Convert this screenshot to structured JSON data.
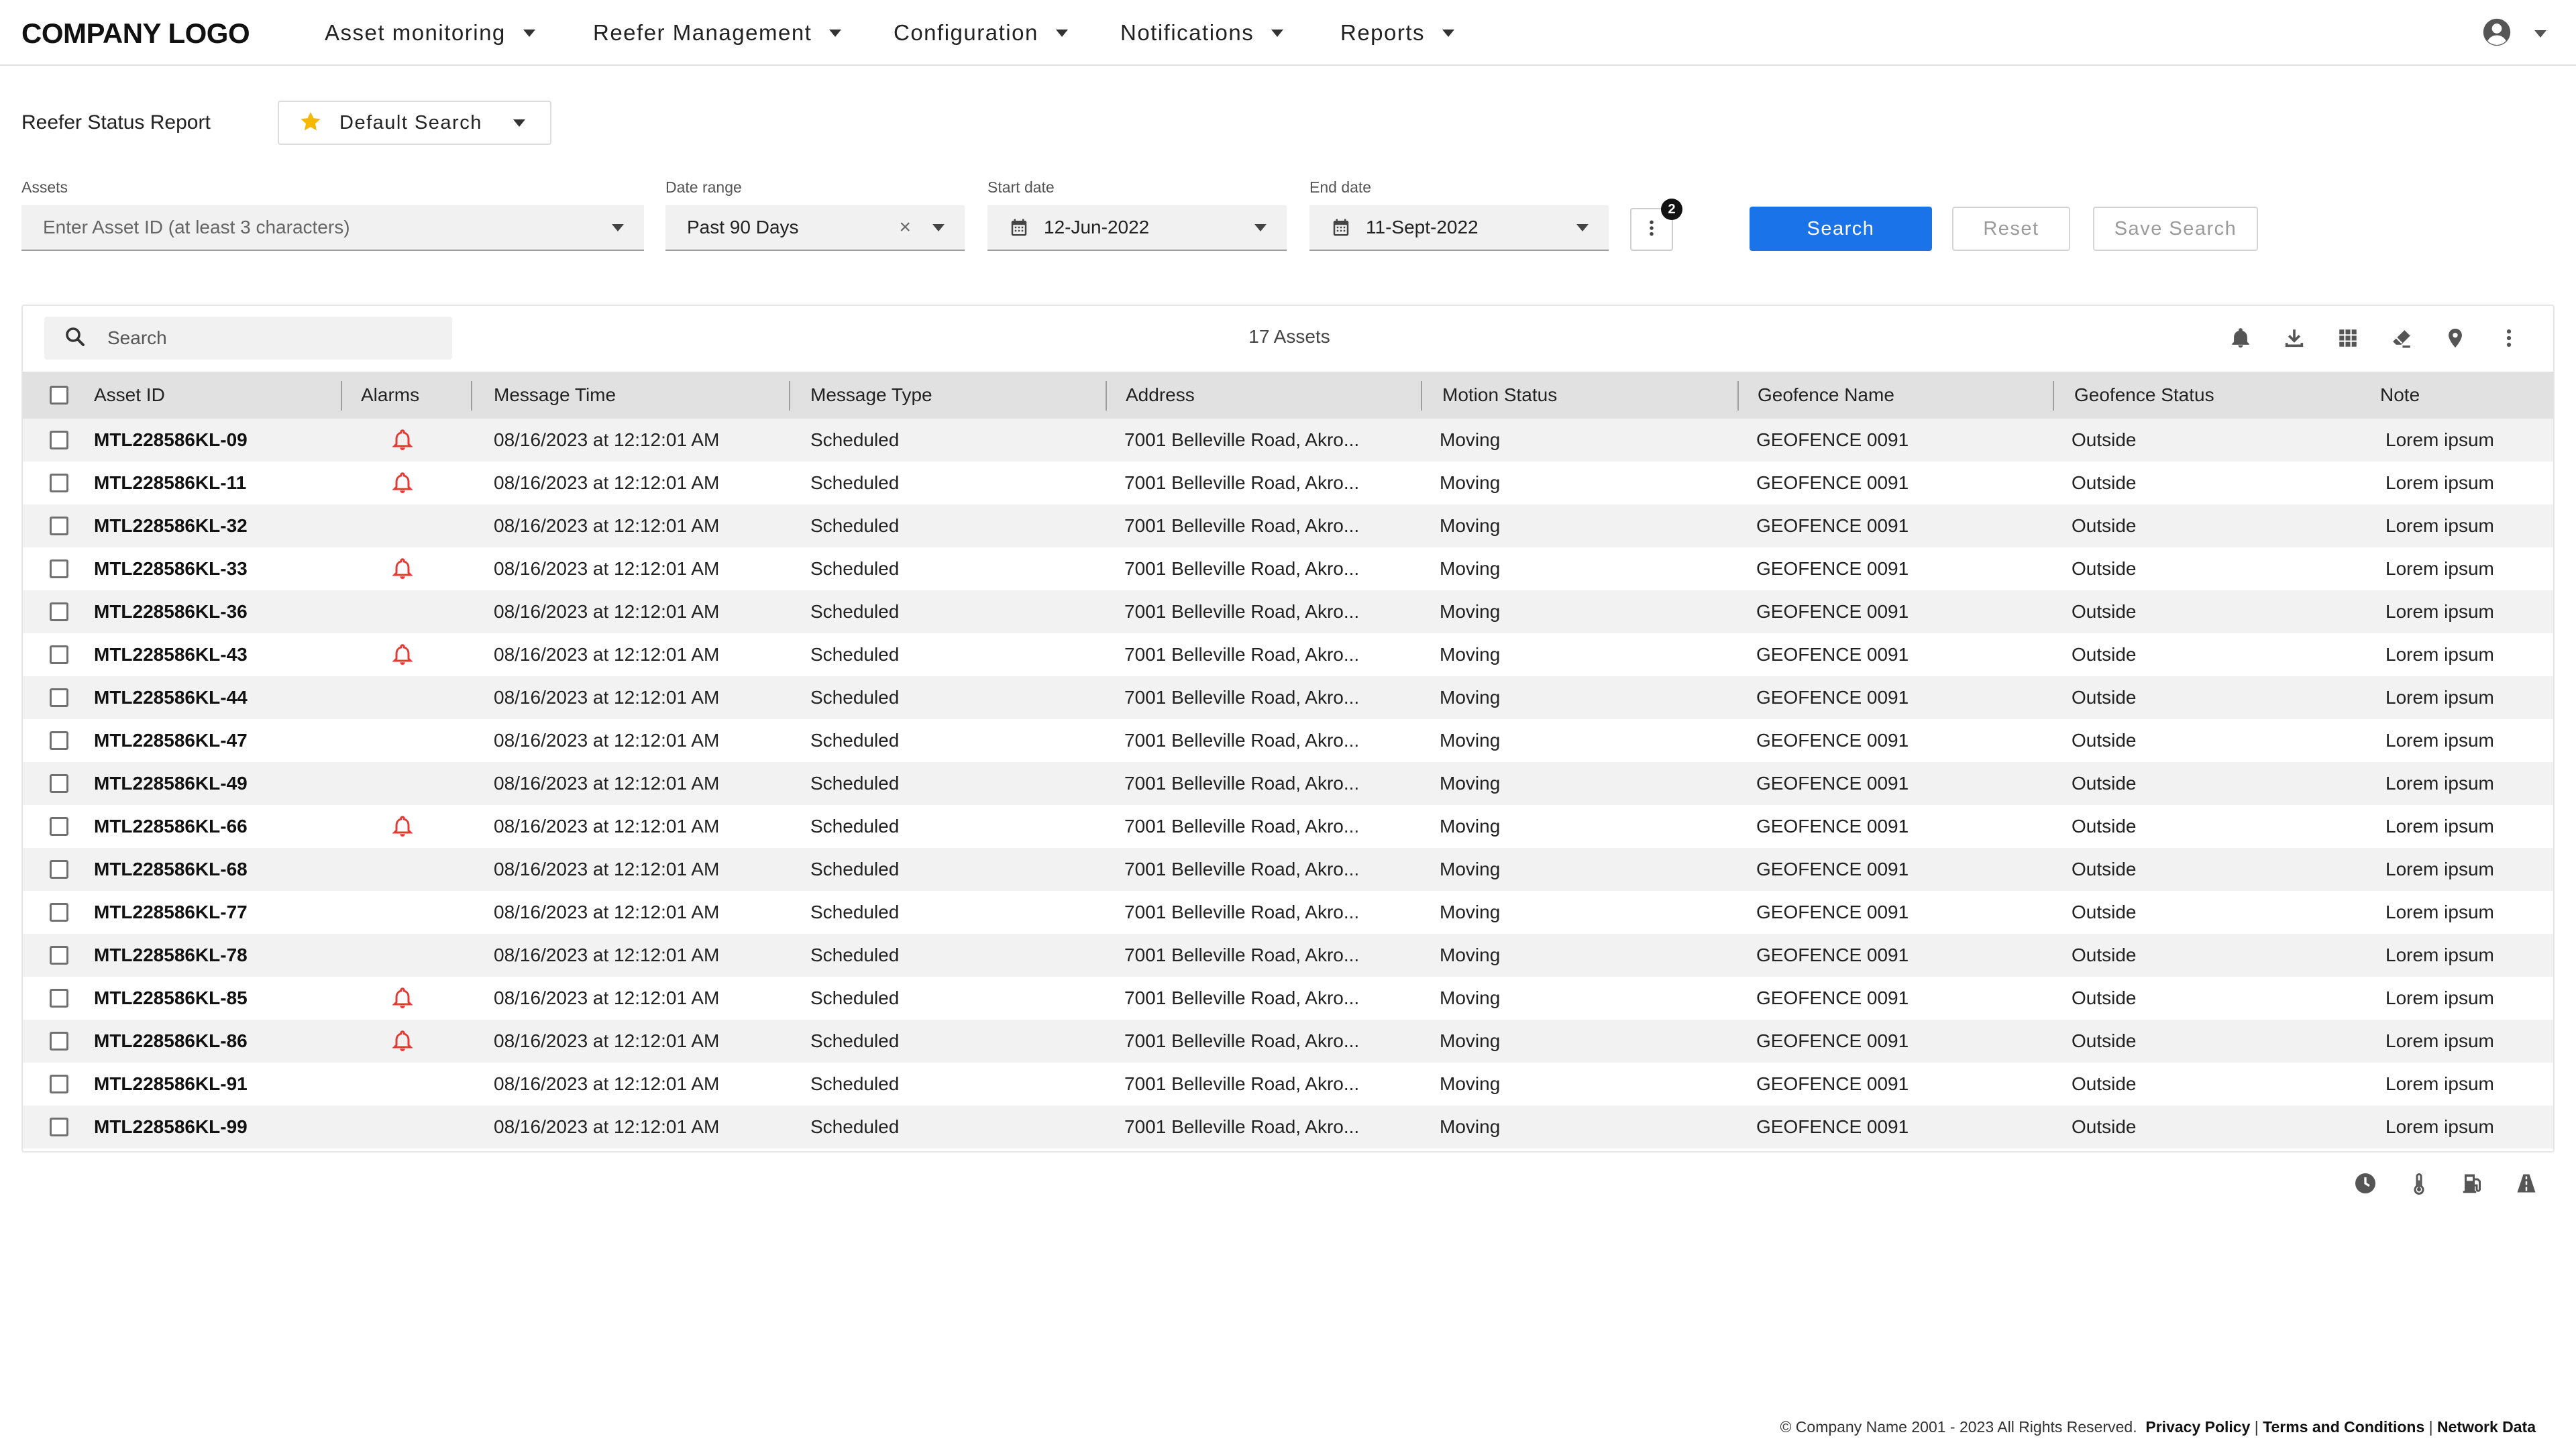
{
  "header": {
    "logo": "COMPANY LOGO",
    "nav": [
      "Asset monitoring",
      "Reefer Management",
      "Configuration",
      "Notifications",
      "Reports"
    ]
  },
  "report": {
    "title": "Reefer Status Report",
    "saved_search": "Default Search"
  },
  "filters": {
    "assets_label": "Assets",
    "assets_placeholder": "Enter Asset ID (at least 3 characters)",
    "date_range_label": "Date range",
    "date_range_value": "Past 90 Days",
    "start_label": "Start date",
    "start_value": "12-Jun-2022",
    "end_label": "End date",
    "end_value": "11-Sept-2022",
    "more_badge": "2"
  },
  "buttons": {
    "search": "Search",
    "reset": "Reset",
    "save_search": "Save Search"
  },
  "table": {
    "search_placeholder": "Search",
    "count": "17 Assets",
    "columns": [
      "Asset ID",
      "Alarms",
      "Message Time",
      "Message Type",
      "Address",
      "Motion Status",
      "Geofence Name",
      "Geofence Status",
      "Note"
    ],
    "rows": [
      {
        "id": "MTL228586KL-09",
        "alarm": true,
        "time": "08/16/2023 at 12:12:01 AM",
        "type": "Scheduled",
        "address": "7001 Belleville Road, Akro...",
        "motion": "Moving",
        "geofence": "GEOFENCE 0091",
        "gstatus": "Outside",
        "note": "Lorem ipsum"
      },
      {
        "id": "MTL228586KL-11",
        "alarm": true,
        "time": "08/16/2023 at 12:12:01 AM",
        "type": "Scheduled",
        "address": "7001 Belleville Road, Akro...",
        "motion": "Moving",
        "geofence": "GEOFENCE 0091",
        "gstatus": "Outside",
        "note": "Lorem ipsum"
      },
      {
        "id": "MTL228586KL-32",
        "alarm": false,
        "time": "08/16/2023 at 12:12:01 AM",
        "type": "Scheduled",
        "address": "7001 Belleville Road, Akro...",
        "motion": "Moving",
        "geofence": "GEOFENCE 0091",
        "gstatus": "Outside",
        "note": "Lorem ipsum"
      },
      {
        "id": "MTL228586KL-33",
        "alarm": true,
        "time": "08/16/2023 at 12:12:01 AM",
        "type": "Scheduled",
        "address": "7001 Belleville Road, Akro...",
        "motion": "Moving",
        "geofence": "GEOFENCE 0091",
        "gstatus": "Outside",
        "note": "Lorem ipsum"
      },
      {
        "id": "MTL228586KL-36",
        "alarm": false,
        "time": "08/16/2023 at 12:12:01 AM",
        "type": "Scheduled",
        "address": "7001 Belleville Road, Akro...",
        "motion": "Moving",
        "geofence": "GEOFENCE 0091",
        "gstatus": "Outside",
        "note": "Lorem ipsum"
      },
      {
        "id": "MTL228586KL-43",
        "alarm": true,
        "time": "08/16/2023 at 12:12:01 AM",
        "type": "Scheduled",
        "address": "7001 Belleville Road, Akro...",
        "motion": "Moving",
        "geofence": "GEOFENCE 0091",
        "gstatus": "Outside",
        "note": "Lorem ipsum"
      },
      {
        "id": "MTL228586KL-44",
        "alarm": false,
        "time": "08/16/2023 at 12:12:01 AM",
        "type": "Scheduled",
        "address": "7001 Belleville Road, Akro...",
        "motion": "Moving",
        "geofence": "GEOFENCE 0091",
        "gstatus": "Outside",
        "note": "Lorem ipsum"
      },
      {
        "id": "MTL228586KL-47",
        "alarm": false,
        "time": "08/16/2023 at 12:12:01 AM",
        "type": "Scheduled",
        "address": "7001 Belleville Road, Akro...",
        "motion": "Moving",
        "geofence": "GEOFENCE 0091",
        "gstatus": "Outside",
        "note": "Lorem ipsum"
      },
      {
        "id": "MTL228586KL-49",
        "alarm": false,
        "time": "08/16/2023 at 12:12:01 AM",
        "type": "Scheduled",
        "address": "7001 Belleville Road, Akro...",
        "motion": "Moving",
        "geofence": "GEOFENCE 0091",
        "gstatus": "Outside",
        "note": "Lorem ipsum"
      },
      {
        "id": "MTL228586KL-66",
        "alarm": true,
        "time": "08/16/2023 at 12:12:01 AM",
        "type": "Scheduled",
        "address": "7001 Belleville Road, Akro...",
        "motion": "Moving",
        "geofence": "GEOFENCE 0091",
        "gstatus": "Outside",
        "note": "Lorem ipsum"
      },
      {
        "id": "MTL228586KL-68",
        "alarm": false,
        "time": "08/16/2023 at 12:12:01 AM",
        "type": "Scheduled",
        "address": "7001 Belleville Road, Akro...",
        "motion": "Moving",
        "geofence": "GEOFENCE 0091",
        "gstatus": "Outside",
        "note": "Lorem ipsum"
      },
      {
        "id": "MTL228586KL-77",
        "alarm": false,
        "time": "08/16/2023 at 12:12:01 AM",
        "type": "Scheduled",
        "address": "7001 Belleville Road, Akro...",
        "motion": "Moving",
        "geofence": "GEOFENCE 0091",
        "gstatus": "Outside",
        "note": "Lorem ipsum"
      },
      {
        "id": "MTL228586KL-78",
        "alarm": false,
        "time": "08/16/2023 at 12:12:01 AM",
        "type": "Scheduled",
        "address": "7001 Belleville Road, Akro...",
        "motion": "Moving",
        "geofence": "GEOFENCE 0091",
        "gstatus": "Outside",
        "note": "Lorem ipsum"
      },
      {
        "id": "MTL228586KL-85",
        "alarm": true,
        "time": "08/16/2023 at 12:12:01 AM",
        "type": "Scheduled",
        "address": "7001 Belleville Road, Akro...",
        "motion": "Moving",
        "geofence": "GEOFENCE 0091",
        "gstatus": "Outside",
        "note": "Lorem ipsum"
      },
      {
        "id": "MTL228586KL-86",
        "alarm": true,
        "time": "08/16/2023 at 12:12:01 AM",
        "type": "Scheduled",
        "address": "7001 Belleville Road, Akro...",
        "motion": "Moving",
        "geofence": "GEOFENCE 0091",
        "gstatus": "Outside",
        "note": "Lorem ipsum"
      },
      {
        "id": "MTL228586KL-91",
        "alarm": false,
        "time": "08/16/2023 at 12:12:01 AM",
        "type": "Scheduled",
        "address": "7001 Belleville Road, Akro...",
        "motion": "Moving",
        "geofence": "GEOFENCE 0091",
        "gstatus": "Outside",
        "note": "Lorem ipsum"
      },
      {
        "id": "MTL228586KL-99",
        "alarm": false,
        "time": "08/16/2023 at 12:12:01 AM",
        "type": "Scheduled",
        "address": "7001 Belleville Road, Akro...",
        "motion": "Moving",
        "geofence": "GEOFENCE 0091",
        "gstatus": "Outside",
        "note": "Lorem ipsum"
      }
    ]
  },
  "icons": {
    "toolbar": [
      "bell-icon",
      "download-icon",
      "grid-view-icon",
      "eraser-icon",
      "location-pin-icon",
      "more-vertical-icon"
    ],
    "bottom": [
      "clock-icon",
      "thermometer-icon",
      "fuel-icon",
      "road-icon"
    ]
  },
  "colors": {
    "primary": "#1a73e8",
    "alarm": "#e53935",
    "star": "#f5b800"
  },
  "footer": {
    "copyright": "© Company Name 2001 - 2023 All Rights Reserved.",
    "privacy": "Privacy Policy",
    "terms": "Terms and Conditions",
    "network": "Network Data"
  }
}
